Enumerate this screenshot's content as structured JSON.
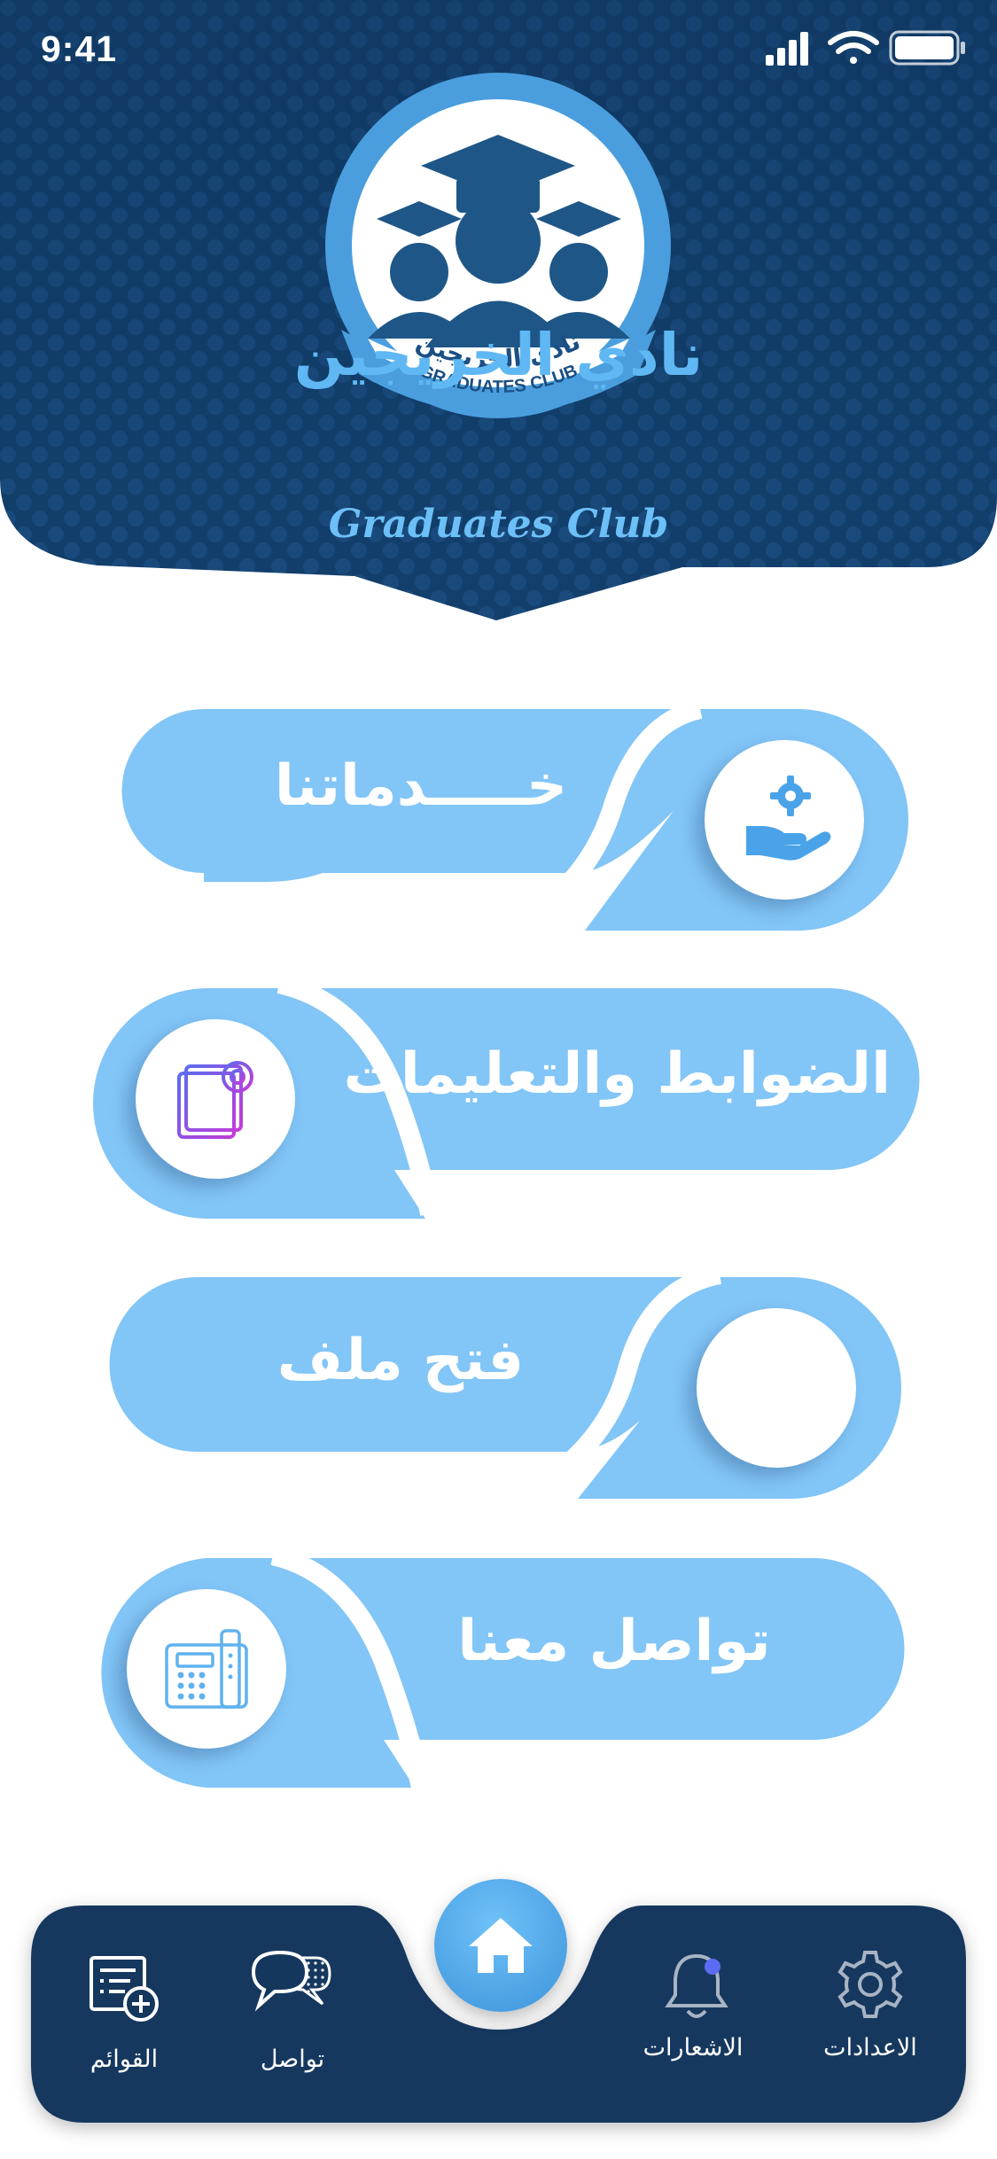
{
  "status_bar": {
    "time": "9:41"
  },
  "header": {
    "title_ar": "نادي الخريجين",
    "title_en": "Graduates Club",
    "logo_ribbon_ar": "نادي الخريجين",
    "logo_ribbon_en": "GRADUATES CLUB"
  },
  "menu": {
    "services": {
      "label": "خـــــدماتنا",
      "icon": "hand-gear-icon"
    },
    "regulations": {
      "label": "الضوابط والتعليمات",
      "icon": "document-settings-icon"
    },
    "open_file": {
      "label": "فتح ملف",
      "icon": ""
    },
    "contact": {
      "label": "تواصل معنا",
      "icon": "desk-phone-icon"
    }
  },
  "bottom_nav": {
    "lists": {
      "label": "القوائم",
      "icon": "list-add-icon"
    },
    "chat": {
      "label": "تواصل",
      "icon": "chat-bubbles-icon"
    },
    "home": {
      "icon": "home-icon"
    },
    "notifications": {
      "label": "الاشعارات",
      "icon": "bell-icon"
    },
    "settings": {
      "label": "الاعدادات",
      "icon": "gear-icon"
    }
  },
  "colors": {
    "header_dark": "#0f3a64",
    "card_blue": "#82c5f7",
    "nav_dark": "#14375e",
    "accent": "#4f9de2",
    "text_light": "#ffffff"
  }
}
